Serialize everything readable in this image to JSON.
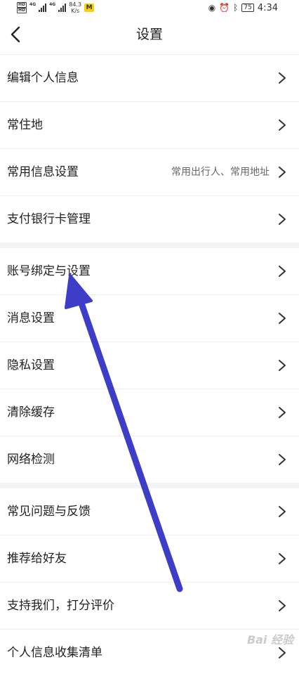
{
  "status_bar": {
    "hd_top": "HD",
    "hd_bottom": "HD",
    "net1": "4G",
    "net2": "4G",
    "speed": "84.3\nK/s",
    "notif": "M",
    "battery": "75",
    "time": "4:34",
    "icons": [
      "eye-icon",
      "alarm-icon",
      "bluetooth-icon"
    ]
  },
  "header": {
    "title": "设置",
    "back_icon": "chevron-left-icon"
  },
  "groups": [
    {
      "items": [
        {
          "label": "编辑个人信息",
          "sub": ""
        },
        {
          "label": "常住地",
          "sub": ""
        },
        {
          "label": "常用信息设置",
          "sub": "常用出行人、常用地址"
        },
        {
          "label": "支付银行卡管理",
          "sub": ""
        }
      ]
    },
    {
      "items": [
        {
          "label": "账号绑定与设置",
          "sub": ""
        },
        {
          "label": "消息设置",
          "sub": ""
        },
        {
          "label": "隐私设置",
          "sub": ""
        },
        {
          "label": "清除缓存",
          "sub": ""
        },
        {
          "label": "网络检测",
          "sub": ""
        }
      ]
    },
    {
      "items": [
        {
          "label": "常见问题与反馈",
          "sub": ""
        },
        {
          "label": "推荐给好友",
          "sub": ""
        },
        {
          "label": "支持我们，打分评价",
          "sub": ""
        },
        {
          "label": "个人信息收集清单",
          "sub": ""
        }
      ]
    }
  ],
  "colors": {
    "arrow": "#3d3dc8",
    "divider": "#eeeeee",
    "group_gap": "#f3f4f6"
  }
}
